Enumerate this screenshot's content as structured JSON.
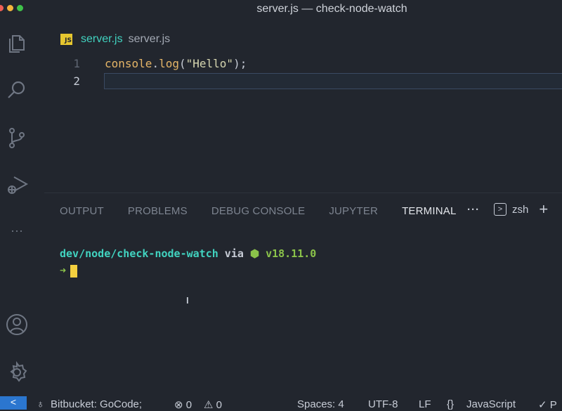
{
  "window": {
    "title": "server.js — check-node-watch"
  },
  "activity_bar": {
    "items": [
      "files-icon",
      "search-icon",
      "source-control-icon",
      "run-debug-icon",
      "more-icon",
      "account-icon",
      "settings-gear-icon"
    ]
  },
  "editor": {
    "tab": {
      "badge": "JS",
      "name": "server.js",
      "description": "server.js"
    },
    "lines": [
      {
        "number": "1",
        "tokens": [
          {
            "t": "console",
            "c": "id"
          },
          {
            "t": ".",
            "c": "punc"
          },
          {
            "t": "log",
            "c": "method"
          },
          {
            "t": "(",
            "c": "punc"
          },
          {
            "t": "\"Hello\"",
            "c": "str"
          },
          {
            "t": ");",
            "c": "punc"
          }
        ]
      },
      {
        "number": "2",
        "tokens": []
      }
    ]
  },
  "panel": {
    "tabs": [
      "OUTPUT",
      "PROBLEMS",
      "DEBUG CONSOLE",
      "JUPYTER",
      "TERMINAL"
    ],
    "active_tab": "TERMINAL",
    "more": "···",
    "shell": "zsh",
    "shell_glyph": ">",
    "add": "+",
    "terminal": {
      "path": "dev/node/check-node-watch",
      "via": " via ",
      "node_icon": "⬢",
      "node_version": " v18.11.0",
      "prompt": "➜"
    }
  },
  "status_bar": {
    "remote": "<",
    "branch_icon": "♁",
    "branch": "Bitbucket: GoCode;",
    "errors": "⊗ 0",
    "warnings": "⚠ 0",
    "spaces": "Spaces: 4",
    "encoding": "UTF-8",
    "eol": "LF",
    "language_icon": "{}",
    "language": "JavaScript",
    "check": "✓ P"
  }
}
